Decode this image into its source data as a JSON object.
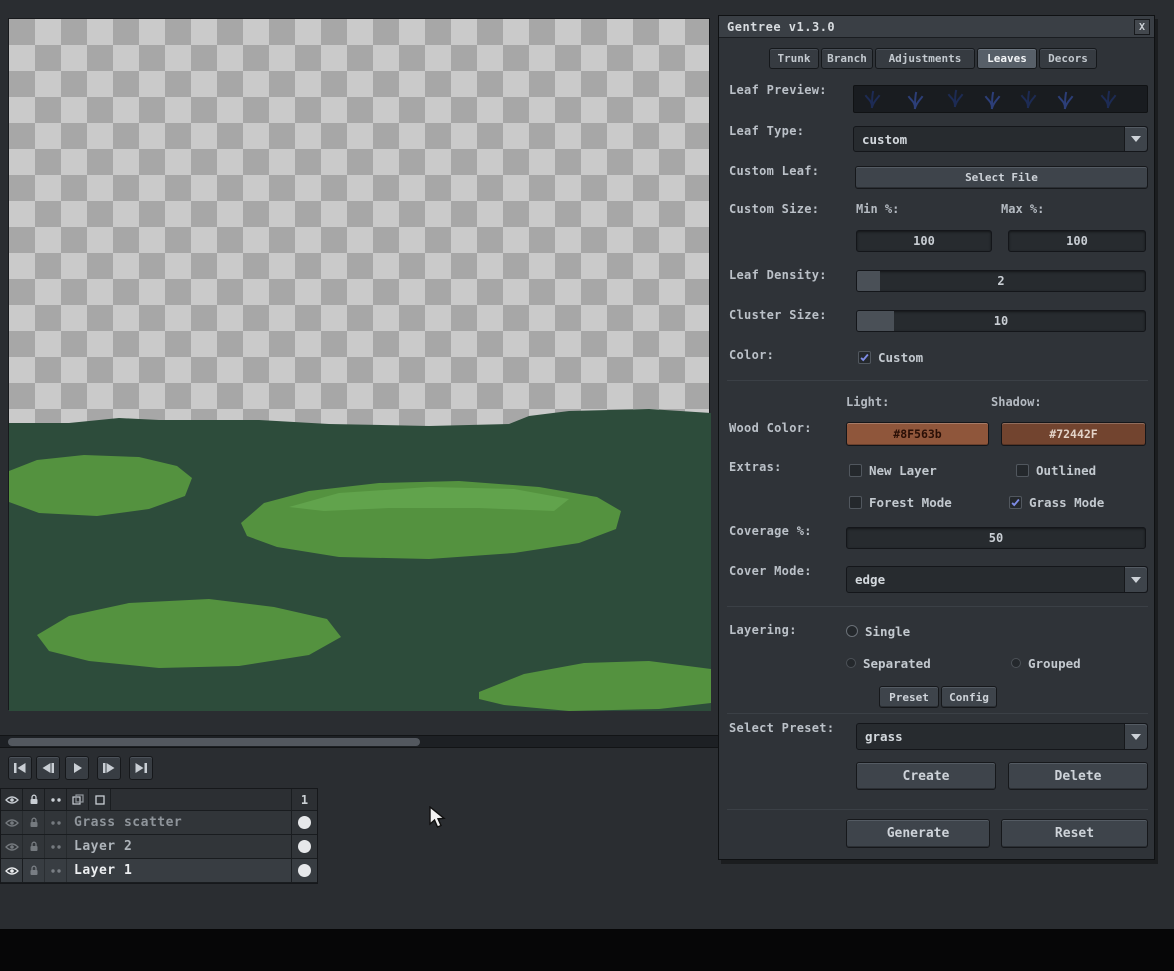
{
  "art": {
    "checker_light": "#cacaca",
    "checker_dark": "#a7a7a7",
    "hill_dark": "#2d4c3b",
    "grass_mid": "#54923f",
    "grass_light": "#61a34c",
    "leaf_navy_dark": "#1d2b54",
    "leaf_navy_light": "#2c3e78"
  },
  "timeline": {
    "frame_number": "1",
    "layers": [
      {
        "name": "Grass scatter",
        "visible": false
      },
      {
        "name": "Layer 2",
        "visible": false
      },
      {
        "name": "Layer 1",
        "visible": true
      }
    ],
    "icons": {
      "playback": [
        "skip-start-icon",
        "prev-frame-icon",
        "play-icon",
        "next-frame-icon",
        "skip-end-icon"
      ],
      "header": [
        "eye-icon",
        "lock-icon",
        "onion-dots-icon",
        "onion-skin-icon",
        "frame-options-icon"
      ]
    }
  },
  "dialog": {
    "title": "Gentree v1.3.0",
    "close_label": "X",
    "tabs": [
      {
        "label": "Trunk",
        "selected": false
      },
      {
        "label": "Branch",
        "selected": false
      },
      {
        "label": "Adjustments",
        "selected": false
      },
      {
        "label": "Leaves",
        "selected": true
      },
      {
        "label": "Decors",
        "selected": false
      }
    ],
    "leaf_preview": {
      "label": "Leaf Preview:"
    },
    "leaf_type": {
      "label": "Leaf Type:",
      "value": "custom"
    },
    "custom_leaf": {
      "label": "Custom Leaf:",
      "button": "Select File"
    },
    "custom_size": {
      "label": "Custom Size:",
      "min_label": "Min %:",
      "max_label": "Max %:",
      "min_value": "100",
      "max_value": "100"
    },
    "leaf_density": {
      "label": "Leaf Density:",
      "value": "2"
    },
    "cluster_size": {
      "label": "Cluster Size:",
      "value": "10"
    },
    "color": {
      "label": "Color:",
      "custom_label": "Custom",
      "custom_checked": true
    },
    "columns": {
      "light": "Light:",
      "shadow": "Shadow:"
    },
    "wood_color": {
      "label": "Wood Color:",
      "light": {
        "hex": "#8F563b",
        "bg": "#8F563B",
        "text_color": "#2a0f06"
      },
      "shadow": {
        "hex": "#72442F",
        "bg": "#72442F",
        "text_color": "#e3d3c8"
      }
    },
    "extras": {
      "label": "Extras:",
      "options": [
        {
          "label": "New Layer",
          "checked": false
        },
        {
          "label": "Outlined",
          "checked": false
        },
        {
          "label": "Forest Mode",
          "checked": false
        },
        {
          "label": "Grass Mode",
          "checked": true
        }
      ]
    },
    "coverage": {
      "label": "Coverage %:",
      "value": "50"
    },
    "cover_mode": {
      "label": "Cover Mode:",
      "value": "edge"
    },
    "layering": {
      "label": "Layering:",
      "options": [
        {
          "label": "Single",
          "selected": false
        },
        {
          "label": "Separated",
          "selected": false
        },
        {
          "label": "Grouped",
          "selected": false
        }
      ]
    },
    "preset_button": "Preset",
    "config_button": "Config",
    "select_preset": {
      "label": "Select Preset:",
      "value": "grass"
    },
    "create_button": "Create",
    "delete_button": "Delete",
    "generate_button": "Generate",
    "reset_button": "Reset",
    "accent_check_color": "#7e8ce6"
  }
}
